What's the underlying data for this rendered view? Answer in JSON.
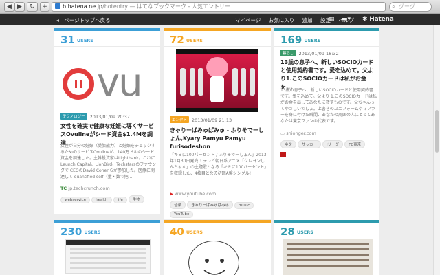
{
  "browser": {
    "url_host": "b.hatena.ne.jp",
    "url_path": "/hotentry",
    "url_title": " — はてなブックマーク - 人気エントリー",
    "search_placeholder": "グーグ",
    "nav": {
      "back": "◀",
      "forward": "▶",
      "reload": "↻",
      "add": "+"
    }
  },
  "topbar": {
    "back_label": "◂　ページトップへ戻る",
    "menu": [
      "マイページ",
      "お気に入り",
      "追加",
      "設定",
      "ヘルプ"
    ],
    "brand": "Hatena"
  },
  "cards": [
    {
      "count": "31",
      "users": "USERS",
      "category": "テクノロジー",
      "category_color": "#2d9bae",
      "date": "2013/01/09 20:37",
      "title": "女性を確実で健康な妊娠に導くサービスOvulineがシード資金$1.4Mを調達",
      "summary": "女性が自分の妊娠（受胎能力）と妊娠をチェックするためのサービスOvulineが、140万ドルのシード資金を調達した。主幹投資家はLightbank。これにLaunch Capital、LionBird、Techstarsのファウンダで CEOのDavid Cohenらが参加した。医療に関連して quantified self（量・数で把...",
      "source": "jp.techcrunch.com",
      "tags": [
        "webservice",
        "health",
        "life",
        "生物"
      ],
      "logo_text": "vu"
    },
    {
      "count": "72",
      "users": "USERS",
      "category": "エンタメ",
      "category_color": "#f5a623",
      "date": "2013/01/09 21:13",
      "title": "きゃりーぱみゅぱみゅ - ふりそでーしょん,Kyary Pamyu Pamyu furisodeshon",
      "summary": "「キミに100パーセント / ふりそでーしょん」2013年1月30日発売!! テレビ朝日系アニメ「クレヨンしんちゃん」の主題歌となる「キミに100パーセント」を収録した、4枚目となる初回A盤シングル!!",
      "source": "www.youtube.com",
      "tags": [
        "音楽",
        "きゃりーぱみゅぱみゅ",
        "music",
        "YouTube"
      ]
    },
    {
      "count": "169",
      "users": "USERS",
      "category": "暮らし",
      "category_color": "#3a9a6a",
      "date": "2013/01/09 18:32",
      "title": "13歳の息子へ、新しいSOCIOカードと使用契約書です。愛を込めて。父より1.このSOCIOカードは私がお金を...",
      "summary": "13歳の息子へ、新しいSOCIOカードと使用契約書です。愛を込めて。父より 1.このSOCIOカードは私がお金を出してあなたに貸すものです。父ちゃんってやさしいでしょ。上書きのユニフォームやマフラーを身に付けた瞬間、あなたの周囲の人にとってあなたは東京ファンの代表です。...",
      "source": "shionger.com",
      "tags": [
        "ネタ",
        "サッカー",
        "Jリーグ",
        "FC東京"
      ]
    },
    {
      "count": "230",
      "users": "USERS"
    },
    {
      "count": "40",
      "users": "USERS"
    },
    {
      "count": "28",
      "users": "USERS"
    }
  ]
}
